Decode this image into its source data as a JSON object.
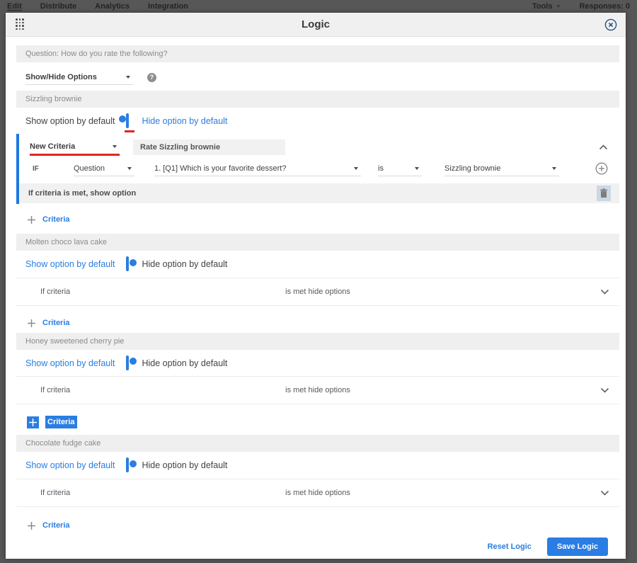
{
  "topbar": {
    "tabs": [
      "Edit",
      "Distribute",
      "Analytics",
      "Integration"
    ],
    "tools": "Tools",
    "responses": "Responses: 0"
  },
  "modal": {
    "title": "Logic",
    "question": "Question: How do you rate the following?",
    "logic_type": "Show/Hide Options",
    "help_icon": "question-mark-circle",
    "close_icon": "circled-x",
    "drag_icon": "dot-grid-handle"
  },
  "sections": [
    {
      "title": "Sizzling brownie",
      "show_label": "Show option by default",
      "hide_label": "Hide option by default",
      "toggle_state": "on",
      "add_criteria_label": "Criteria",
      "criteria": {
        "name_dropdown": "New Criteria",
        "title_value": "Rate Sizzling brownie",
        "if_label": "IF",
        "subject_dropdown": "Question",
        "question_dropdown": "1. [Q1] Which is your favorite dessert?",
        "operator_dropdown": "is",
        "value_dropdown": "Sizzling brownie",
        "result_text": "If criteria is met, show option",
        "collapse_icon": "chevron-up",
        "add_icon": "plus-circle",
        "delete_icon": "trash"
      }
    },
    {
      "title": "Molten choco lava cake",
      "show_label": "Show option by default",
      "hide_label": "Hide option by default",
      "toggle_state": "off",
      "collapsed_left": "If criteria",
      "collapsed_center": "is met hide options",
      "expand_icon": "chevron-down",
      "add_criteria_label": "Criteria"
    },
    {
      "title": "Honey sweetened cherry pie",
      "show_label": "Show option by default",
      "hide_label": "Hide option by default",
      "toggle_state": "off",
      "collapsed_left": "If criteria",
      "collapsed_center": "is met hide options",
      "expand_icon": "chevron-down",
      "add_criteria_label": "Criteria",
      "add_criteria_highlighted": true
    },
    {
      "title": "Chocolate fudge cake",
      "show_label": "Show option by default",
      "hide_label": "Hide option by default",
      "toggle_state": "off",
      "collapsed_left": "If criteria",
      "collapsed_center": "is met hide options",
      "expand_icon": "chevron-down",
      "add_criteria_label": "Criteria"
    }
  ],
  "footer": {
    "reset_label": "Reset Logic",
    "save_label": "Save Logic"
  },
  "colors": {
    "accent_blue": "#2a7de2",
    "annotation_red": "#e0281e",
    "chrome_gray": "#565656",
    "bar_gray": "#efefef"
  }
}
